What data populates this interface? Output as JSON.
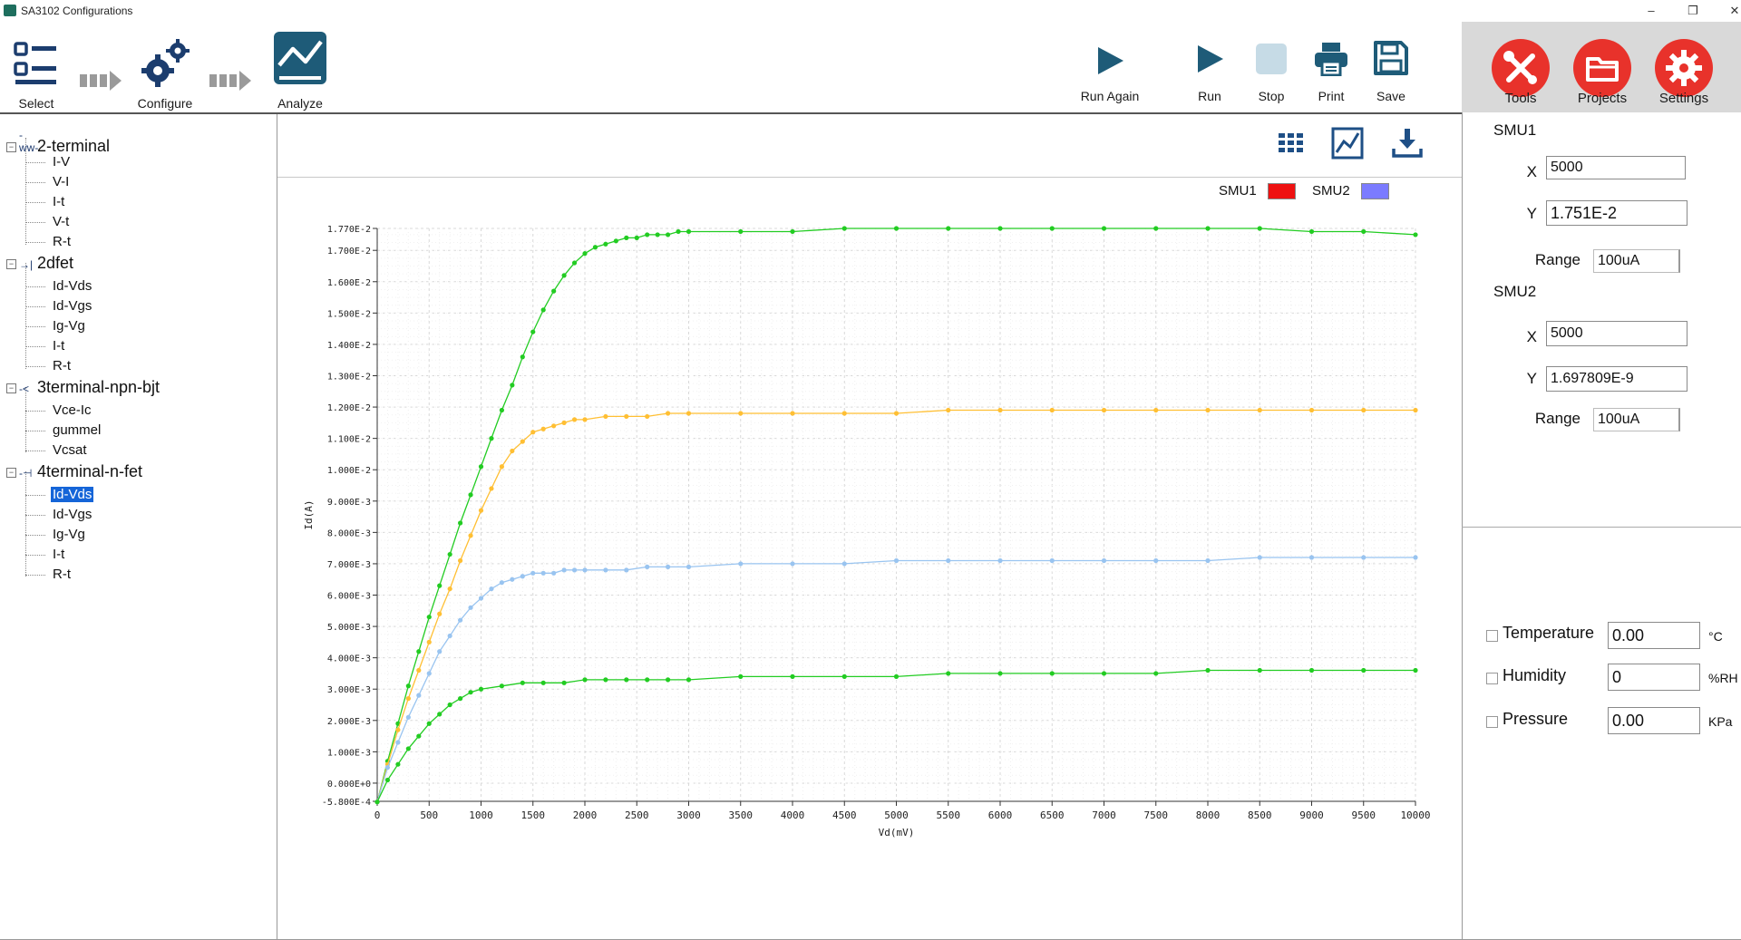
{
  "window": {
    "title": "SA3102 Configurations",
    "controls": [
      "–",
      "❐",
      "✕"
    ]
  },
  "toolbar": {
    "select": "Select",
    "configure": "Configure",
    "analyze": "Analyze",
    "run_again": "Run Again",
    "run": "Run",
    "stop": "Stop",
    "print": "Print",
    "save": "Save"
  },
  "right_header": {
    "tools": "Tools",
    "projects": "Projects",
    "settings": "Settings"
  },
  "tree": {
    "groups": [
      {
        "label": "2-terminal",
        "icon": "resistor-icon",
        "items": [
          "I-V",
          "V-I",
          "I-t",
          "V-t",
          "R-t"
        ]
      },
      {
        "label": "2dfet",
        "icon": "diode-icon",
        "items": [
          "Id-Vds",
          "Id-Vgs",
          "Ig-Vg",
          "I-t",
          "R-t"
        ]
      },
      {
        "label": "3terminal-npn-bjt",
        "icon": "transistor-icon",
        "items": [
          "Vce-Ic",
          "gummel",
          "Vcsat"
        ]
      },
      {
        "label": "4terminal-n-fet",
        "icon": "fet-icon",
        "items": [
          "Id-Vds",
          "Id-Vgs",
          "Ig-Vg",
          "I-t",
          "R-t"
        ],
        "selected_index": 0
      }
    ]
  },
  "legend": {
    "smu1": "SMU1",
    "smu1_color": "#ee1111",
    "smu2": "SMU2",
    "smu2_color": "#7b7bff"
  },
  "right_panel": {
    "smu1": {
      "title": "SMU1",
      "x_label": "X",
      "x": "5000",
      "y_label": "Y",
      "y": "1.751E-2",
      "range_label": "Range",
      "range": "100uA"
    },
    "smu2": {
      "title": "SMU2",
      "x_label": "X",
      "x": "5000",
      "y_label": "Y",
      "y": "1.697809E-9",
      "range_label": "Range",
      "range": "100uA"
    },
    "env": [
      {
        "label": "Temperature",
        "value": "0.00",
        "unit": "°C"
      },
      {
        "label": "Humidity",
        "value": "0",
        "unit": "%RH"
      },
      {
        "label": "Pressure",
        "value": "0.00",
        "unit": "KPa"
      }
    ]
  },
  "chart_data": {
    "type": "line",
    "xlabel": "Vd(mV)",
    "ylabel": "Id(A)",
    "xlim": [
      0,
      10000
    ],
    "ylim": [
      -0.00058,
      0.0177
    ],
    "x_ticks": [
      "0",
      "500",
      "1000",
      "1500",
      "2000",
      "2500",
      "3000",
      "3500",
      "4000",
      "4500",
      "5000",
      "5500",
      "6000",
      "6500",
      "7000",
      "7500",
      "8000",
      "8500",
      "9000",
      "9500",
      "10000"
    ],
    "y_ticks": [
      {
        "value": -0.00058,
        "label": "-5.800E-4"
      },
      {
        "value": 0,
        "label": "0.000E+0"
      },
      {
        "value": 0.001,
        "label": "1.000E-3"
      },
      {
        "value": 0.002,
        "label": "2.000E-3"
      },
      {
        "value": 0.003,
        "label": "3.000E-3"
      },
      {
        "value": 0.004,
        "label": "4.000E-3"
      },
      {
        "value": 0.005,
        "label": "5.000E-3"
      },
      {
        "value": 0.006,
        "label": "6.000E-3"
      },
      {
        "value": 0.007,
        "label": "7.000E-3"
      },
      {
        "value": 0.008,
        "label": "8.000E-3"
      },
      {
        "value": 0.009,
        "label": "9.000E-3"
      },
      {
        "value": 0.01,
        "label": "1.000E-2"
      },
      {
        "value": 0.011,
        "label": "1.100E-2"
      },
      {
        "value": 0.012,
        "label": "1.200E-2"
      },
      {
        "value": 0.013,
        "label": "1.300E-2"
      },
      {
        "value": 0.014,
        "label": "1.400E-2"
      },
      {
        "value": 0.015,
        "label": "1.500E-2"
      },
      {
        "value": 0.016,
        "label": "1.600E-2"
      },
      {
        "value": 0.017,
        "label": "1.700E-2"
      },
      {
        "value": 0.0177,
        "label": "1.770E-2"
      }
    ],
    "grid": true,
    "series": [
      {
        "color": "#22cc22",
        "x": [
          0,
          100,
          200,
          300,
          400,
          500,
          600,
          700,
          800,
          900,
          1000,
          1100,
          1200,
          1300,
          1400,
          1500,
          1600,
          1700,
          1800,
          1900,
          2000,
          2100,
          2200,
          2300,
          2400,
          2500,
          2600,
          2700,
          2800,
          2900,
          3000,
          3500,
          4000,
          4500,
          5000,
          5500,
          6000,
          6500,
          7000,
          7500,
          8000,
          8500,
          9000,
          9500,
          10000
        ],
        "y": [
          -0.0006,
          0.0007,
          0.0019,
          0.0031,
          0.0042,
          0.0053,
          0.0063,
          0.0073,
          0.0083,
          0.0092,
          0.0101,
          0.011,
          0.0119,
          0.0127,
          0.0136,
          0.0144,
          0.0151,
          0.0157,
          0.0162,
          0.0166,
          0.0169,
          0.0171,
          0.0172,
          0.0173,
          0.0174,
          0.0174,
          0.0175,
          0.0175,
          0.0175,
          0.0176,
          0.0176,
          0.0176,
          0.0176,
          0.0177,
          0.0177,
          0.0177,
          0.0177,
          0.0177,
          0.0177,
          0.0177,
          0.0177,
          0.0177,
          0.0176,
          0.0176,
          0.0175
        ]
      },
      {
        "color": "#ffbf33",
        "x": [
          0,
          100,
          200,
          300,
          400,
          500,
          600,
          700,
          800,
          900,
          1000,
          1100,
          1200,
          1300,
          1400,
          1500,
          1600,
          1700,
          1800,
          1900,
          2000,
          2200,
          2400,
          2600,
          2800,
          3000,
          3500,
          4000,
          4500,
          5000,
          5500,
          6000,
          6500,
          7000,
          7500,
          8000,
          8500,
          9000,
          9500,
          10000
        ],
        "y": [
          -0.0006,
          0.0006,
          0.0017,
          0.0027,
          0.0036,
          0.0045,
          0.0054,
          0.0062,
          0.0071,
          0.0079,
          0.0087,
          0.0094,
          0.0101,
          0.0106,
          0.0109,
          0.0112,
          0.0113,
          0.0114,
          0.0115,
          0.0116,
          0.0116,
          0.0117,
          0.0117,
          0.0117,
          0.0118,
          0.0118,
          0.0118,
          0.0118,
          0.0118,
          0.0118,
          0.0119,
          0.0119,
          0.0119,
          0.0119,
          0.0119,
          0.0119,
          0.0119,
          0.0119,
          0.0119,
          0.0119
        ]
      },
      {
        "color": "#99c4f0",
        "x": [
          0,
          100,
          200,
          300,
          400,
          500,
          600,
          700,
          800,
          900,
          1000,
          1100,
          1200,
          1300,
          1400,
          1500,
          1600,
          1700,
          1800,
          1900,
          2000,
          2200,
          2400,
          2600,
          2800,
          3000,
          3500,
          4000,
          4500,
          5000,
          5500,
          6000,
          6500,
          7000,
          7500,
          8000,
          8500,
          9000,
          9500,
          10000
        ],
        "y": [
          -0.0006,
          0.0005,
          0.0013,
          0.0021,
          0.0028,
          0.0035,
          0.0042,
          0.0047,
          0.0052,
          0.0056,
          0.0059,
          0.0062,
          0.0064,
          0.0065,
          0.0066,
          0.0067,
          0.0067,
          0.0067,
          0.0068,
          0.0068,
          0.0068,
          0.0068,
          0.0068,
          0.0069,
          0.0069,
          0.0069,
          0.007,
          0.007,
          0.007,
          0.0071,
          0.0071,
          0.0071,
          0.0071,
          0.0071,
          0.0071,
          0.0071,
          0.0072,
          0.0072,
          0.0072,
          0.0072
        ]
      },
      {
        "color": "#22cc22",
        "x": [
          0,
          100,
          200,
          300,
          400,
          500,
          600,
          700,
          800,
          900,
          1000,
          1200,
          1400,
          1600,
          1800,
          2000,
          2200,
          2400,
          2600,
          2800,
          3000,
          3500,
          4000,
          4500,
          5000,
          5500,
          6000,
          6500,
          7000,
          7500,
          8000,
          8500,
          9000,
          9500,
          10000
        ],
        "y": [
          -0.0006,
          0.0001,
          0.0006,
          0.0011,
          0.0015,
          0.0019,
          0.0022,
          0.0025,
          0.0027,
          0.0029,
          0.003,
          0.0031,
          0.0032,
          0.0032,
          0.0032,
          0.0033,
          0.0033,
          0.0033,
          0.0033,
          0.0033,
          0.0033,
          0.0034,
          0.0034,
          0.0034,
          0.0034,
          0.0035,
          0.0035,
          0.0035,
          0.0035,
          0.0035,
          0.0036,
          0.0036,
          0.0036,
          0.0036,
          0.0036
        ]
      }
    ]
  }
}
